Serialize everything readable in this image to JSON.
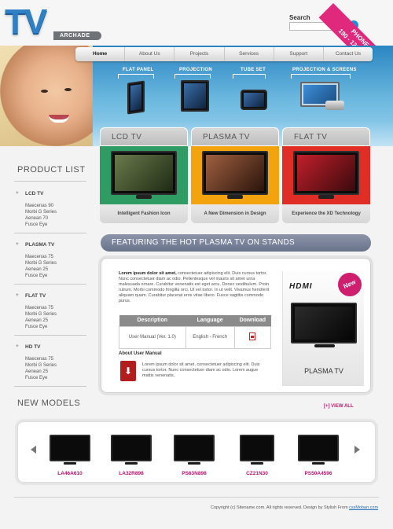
{
  "logo": {
    "main": "TV",
    "sub": "ARCHADE"
  },
  "search": {
    "label": "Search",
    "placeholder": "",
    "button_icon": "arrow-right-icon"
  },
  "phone": {
    "label": "PHONE #",
    "number": "190 - 123 - 7896"
  },
  "nav": {
    "items": [
      "Home",
      "About Us",
      "Projects",
      "Services",
      "Support",
      "Contact Us"
    ],
    "active": "Home"
  },
  "banner": {
    "categories": [
      "FLAT PANEL",
      "PROJECTION",
      "TUBE SET",
      "PROJECTION & SCREENS"
    ]
  },
  "product_tabs": [
    {
      "title": "LCD TV",
      "caption": "Intelligent Fashion Icon",
      "color": "#2e9c63"
    },
    {
      "title": "PLASMA TV",
      "caption": "A New Dimension in Design",
      "color": "#f2a30d"
    },
    {
      "title": "FLAT TV",
      "caption": "Experience the XD Technology",
      "color": "#e02d25"
    }
  ],
  "sidebar": {
    "title": "PRODUCT LIST",
    "groups": [
      {
        "head": "LCD TV",
        "items": [
          "Maecenas 90",
          "Morbi G Series",
          "Aenean 70",
          "Fusce Eye"
        ]
      },
      {
        "head": "PLASMA TV",
        "items": [
          "Maecenas 75",
          "Morbi G Series",
          "Aenean 25",
          "Fusce Eye"
        ]
      },
      {
        "head": "FLAT TV",
        "items": [
          "Maecenas 75",
          "Morbi G Series",
          "Aenean 25",
          "Fusce Eye"
        ]
      },
      {
        "head": "HD TV",
        "items": [
          "Maecenas 75",
          "Morbi G Series",
          "Aenean 25",
          "Fusce Eye"
        ]
      }
    ]
  },
  "featuring": {
    "title": "FEATURING THE HOT PLASMA TV ON STANDS",
    "intro_bold": "Lorem ipsum dolor sit amet,",
    "intro_rest": " consectetuer adipiscing elit. Duis cursus tortor. Nunc consectetuer diam ac odio. Pellentesque vel mauris sit amet urna malesuada ornare. Curabitur venenatis est eget arcu. Donec vestibulum. Proin rutrum. Morbi commodo fringilla orci. Ut vel tortor. In ut velit. Vivamus hendrerit aliquam quam. Curabitur placerat eros vitae libero. Fusce sagittis commodo purus.",
    "table": {
      "headers": [
        "Description",
        "Language",
        "Download"
      ],
      "row": [
        "User Manual (Ver. 1.0)",
        "English - French"
      ]
    },
    "about_title": "About User Manual",
    "about_text": "Lorem ipsum dolor sit amet, consectetuer adipiscing elit. Duis cursus tortor. Nunc consectetuer diam ac odio. Lorem augue mattis venenatis.",
    "hdmi": {
      "logo": "HDMI",
      "badge": "New",
      "caption": "PLASMA TV"
    }
  },
  "new_models": {
    "title": "NEW MODELS",
    "view_all": "[+] VIEW ALL",
    "items": [
      "LA46A610",
      "LA32R898",
      "PS63N898",
      "CZ21N30",
      "PS50A4596"
    ]
  },
  "footer": {
    "text": "Copyright (c) Sitename.com. All rights reserved. Design by Stylish From",
    "link": "cssMoban.com"
  }
}
